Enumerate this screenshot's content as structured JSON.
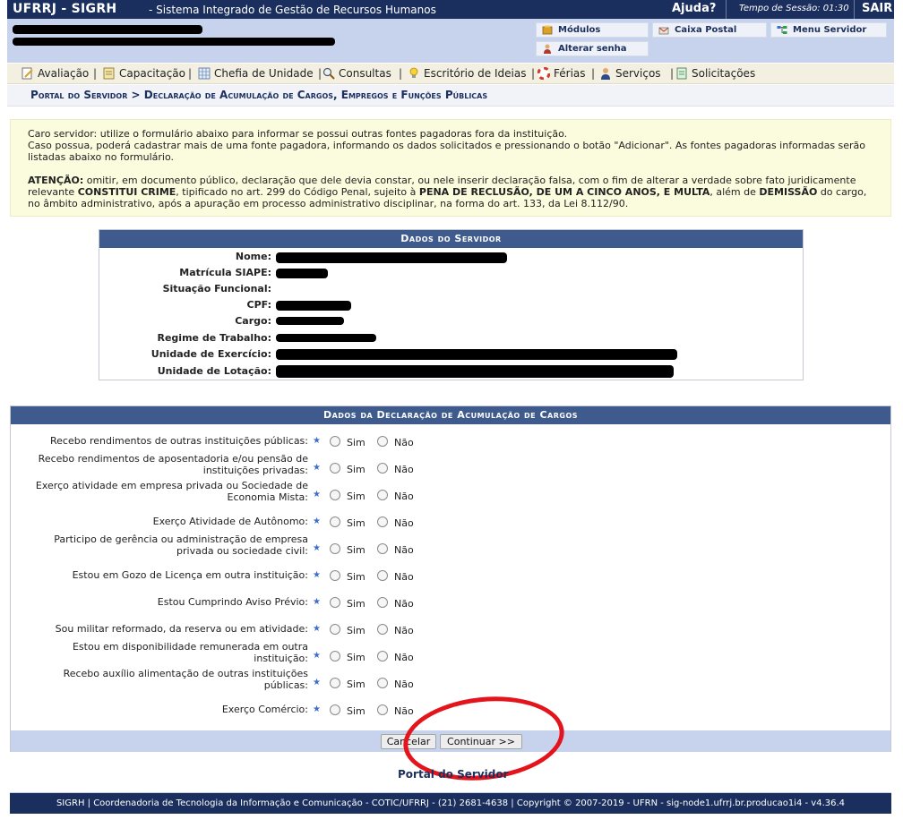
{
  "topbar": {
    "system": "UFRRJ - SIGRH",
    "description": "- Sistema Integrado de Gestão de Recursos Humanos",
    "help": "Ajuda?",
    "session": "Tempo de Sessão: 01:30",
    "logout": "SAIR"
  },
  "userarea": {
    "modules": "Módulos",
    "mailbox": "Caixa Postal",
    "server_menu": "Menu Servidor",
    "change_password": "Alterar senha"
  },
  "menu": {
    "items": [
      "Avaliação",
      "Capacitação",
      "Chefia de Unidade",
      "Consultas",
      "Escritório de Ideias",
      "Férias",
      "Serviços",
      "Solicitações"
    ]
  },
  "breadcrumb": "Portal do Servidor > Declaração de Acumulação de Cargos, Empregos e Funções Públicas",
  "notice": {
    "line1": "Caro servidor: utilize o formulário abaixo para informar se possui outras fontes pagadoras fora da instituição.",
    "line2": "Caso possua, poderá cadastrar mais de uma fonte pagadora, informando os dados solicitados e pressionando o botão \"Adicionar\". As fontes pagadoras informadas serão listadas abaixo no formulário.",
    "attention_label": "ATENÇÃO:",
    "attention_a": "omitir, em documento público, declaração que dele devia constar, ou nele inserir declaração falsa, com o fim de alterar a verdade sobre fato juridicamente relevante",
    "crime": "CONSTITUI CRIME",
    "attention_b": ", tipificado no art. 299 do Código Penal, sujeito à",
    "penalty": "PENA DE RECLUSÃO, DE UM A CINCO ANOS, E MULTA",
    "attention_c": ", além de",
    "dismissal": "DEMISSÃO",
    "attention_d": "do cargo, no âmbito administrativo, após a apuração em processo administrativo disciplinar, na forma do art. 133, da Lei 8.112/90."
  },
  "servidor": {
    "caption": "Dados do Servidor",
    "labels": [
      "Nome:",
      "Matrícula SIAPE:",
      "Situação Funcional:",
      "CPF:",
      "Cargo:",
      "Regime de Trabalho:",
      "Unidade de Exercício:",
      "Unidade de Lotação:"
    ]
  },
  "declaracao": {
    "caption": "Dados da Declaração de Acumulação de Cargos",
    "yes": "Sim",
    "no": "Não",
    "questions": [
      [
        "Recebo rendimentos de outras instituições públicas:"
      ],
      [
        "Recebo rendimentos de aposentadoria e/ou pensão de",
        "instituições privadas:"
      ],
      [
        "Exerço atividade em empresa privada ou Sociedade de",
        "Economia Mista:"
      ],
      [
        "Exerço Atividade de Autônomo:"
      ],
      [
        "Participo de gerência ou administração de empresa",
        "privada ou sociedade civil:"
      ],
      [
        "Estou em Gozo de Licença em outra instituição:"
      ],
      [
        "Estou Cumprindo Aviso Prévio:"
      ],
      [
        "Sou militar reformado, da reserva ou em atividade:"
      ],
      [
        "Estou em disponibilidade remunerada em outra",
        "instituição:"
      ],
      [
        "Recebo auxílio alimentação de outras instituições",
        "públicas:"
      ],
      [
        "Exerço Comércio:"
      ]
    ],
    "cancel": "Cancelar",
    "continue": "Continuar >>"
  },
  "portal_link": "Portal do Servidor",
  "footer": "SIGRH | Coordenadoria de Tecnologia da Informação e Comunicação - COTIC/UFRRJ - (21) 2681-4638 | Copyright © 2007-2019 - UFRN - sig-node1.ufrrj.br.producao1i4 - v4.36.4",
  "colors": {
    "header_navy": "#1b2f5e",
    "caption_blue": "#3f5b8e",
    "light_blue": "#c7d2ec",
    "notice_yellow": "#fbfbdd",
    "annotation_red": "#e3141b"
  },
  "icons": [
    "modules-icon",
    "mailbox-icon",
    "server-menu-icon",
    "change-password-icon",
    "evaluation-icon",
    "training-icon",
    "unit-head-icon",
    "search-icon",
    "ideas-icon",
    "vacation-icon",
    "services-icon",
    "requests-icon",
    "required-star-icon"
  ]
}
